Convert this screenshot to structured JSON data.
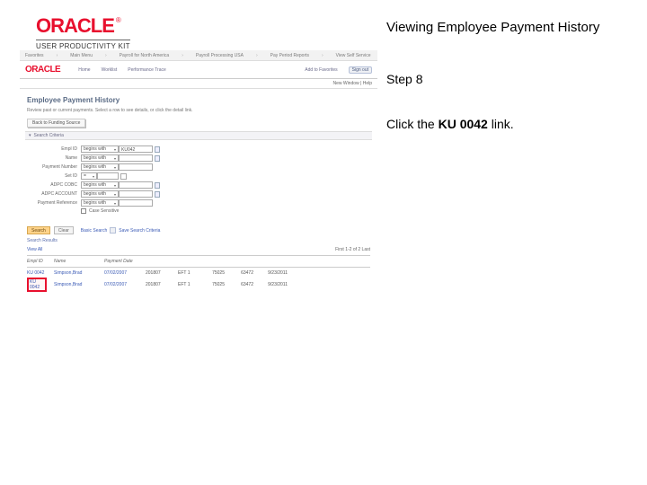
{
  "header": {
    "brand": "ORACLE",
    "brand_tm": "®",
    "product": "USER PRODUCTIVITY KIT",
    "title": "Viewing Employee Payment History"
  },
  "instructions": {
    "step_label": "Step 8",
    "line_pre": "Click the ",
    "link_text": "KU 0042",
    "line_post": " link."
  },
  "app": {
    "breadcrumb": {
      "items": [
        "Favorites",
        "Main Menu",
        "Payroll for North America",
        "Payroll Processing USA",
        "Pay Period Reports",
        "View Self Service"
      ],
      "right": [
        "",
        ""
      ]
    },
    "smallnav": {
      "items": [
        "Home",
        "Worklist",
        "Performance Trace"
      ],
      "right1": "Add to Favorites",
      "action": "Sign out"
    },
    "subheader": "New Window | Help",
    "page_title": "Employee Payment History",
    "intro": "Review past or current payments. Select a row to see details, or click the detail link.",
    "tab_button": "Back to Funding Source",
    "search_bar": "Search Criteria",
    "form": {
      "rows": [
        {
          "label": "Empl ID",
          "op": "begins with",
          "value": "KU042"
        },
        {
          "label": "Name",
          "op": "begins with",
          "value": ""
        },
        {
          "label": "Payment Number",
          "op": "begins with",
          "value": ""
        },
        {
          "label": "Set ID",
          "op": "=",
          "value": ""
        },
        {
          "label": "ADPC COBC",
          "op": "begins with",
          "value": ""
        },
        {
          "label": "ADPC ACCOUNT",
          "op": "begins with",
          "value": ""
        },
        {
          "label": "Payment Reference",
          "op": "begins with",
          "value": ""
        }
      ],
      "case_label": "Case Sensitive"
    },
    "buttons": {
      "search": "Search",
      "clear": "Clear",
      "basic": "Basic Search",
      "save": "Save Search Criteria"
    },
    "results": {
      "header": "Search Results",
      "top_left": "View All",
      "top_right": "First 1-2 of 2 Last",
      "cols": [
        "Empl ID",
        "Name",
        "Payment Date",
        "",
        "",
        "",
        "",
        ""
      ],
      "rows": [
        {
          "id": "KU 0042",
          "name": "Simpson,Brad",
          "date": "07/02/2007",
          "c1": "201807",
          "c2": "EFT 1",
          "a1": "75025",
          "a2": "63472",
          "a3": "9/23/2011"
        },
        {
          "id": "KU 0042",
          "name": "Simpson,Brad",
          "date": "07/02/2007",
          "c1": "201807",
          "c2": "EFT 1",
          "a1": "75025",
          "a2": "63472",
          "a3": "9/23/2011"
        }
      ]
    }
  }
}
